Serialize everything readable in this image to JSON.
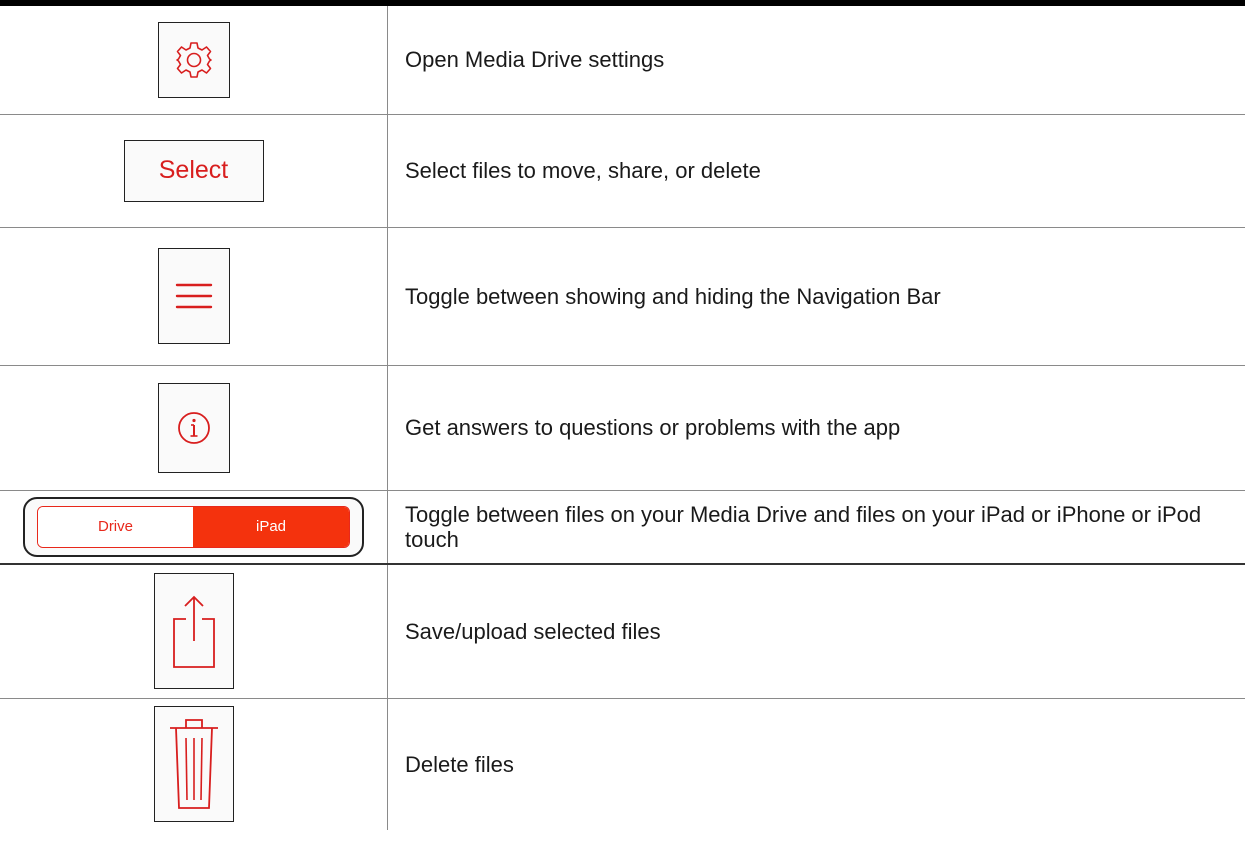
{
  "rows": [
    {
      "icon": "gear-icon",
      "description": "Open Media Drive settings"
    },
    {
      "icon": "select-button",
      "label": "Select",
      "description": "Select files to move, share, or delete"
    },
    {
      "icon": "hamburger-menu-icon",
      "description": "Toggle between showing and hiding the Navigation Bar"
    },
    {
      "icon": "info-icon",
      "description": "Get answers to questions or problems with the app"
    },
    {
      "icon": "drive-ipad-segmented-control",
      "segments": [
        "Drive",
        "iPad"
      ],
      "selected": "iPad",
      "description": "Toggle between files on your Media Drive and files on your iPad or iPhone or iPod touch"
    },
    {
      "icon": "share-upload-icon",
      "description": "Save/upload selected files"
    },
    {
      "icon": "trash-icon",
      "description": "Delete files"
    }
  ],
  "colors": {
    "accent_red": "#d81e1e",
    "segment_selected": "#f4320d",
    "rule": "#000000"
  }
}
